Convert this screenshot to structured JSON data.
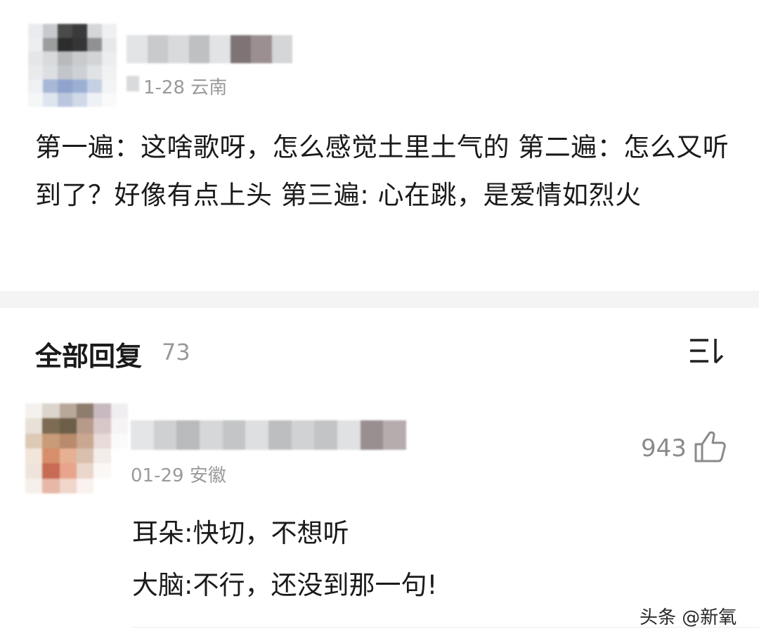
{
  "post": {
    "date_location": "1-28 云南",
    "text": "第一遍：这啥歌呀，怎么感觉土里土气的  第二遍：怎么又听到了？好像有点上头  第三遍: 心在跳，是爱情如烈火"
  },
  "replies_header": {
    "title": "全部回复",
    "count": "73",
    "sort_icon": "sort-icon"
  },
  "reply": {
    "date_location": "01-29 安徽",
    "likes": "943",
    "like_icon": "thumbs-up-icon",
    "lines": [
      "耳朵:快切，不想听",
      "大脑:不行，还没到那一句!"
    ]
  },
  "watermark": "头条 @新氧",
  "colors": {
    "text": "#1a1a1a",
    "muted": "#9a9a9a",
    "divider": "#f4f4f4"
  }
}
